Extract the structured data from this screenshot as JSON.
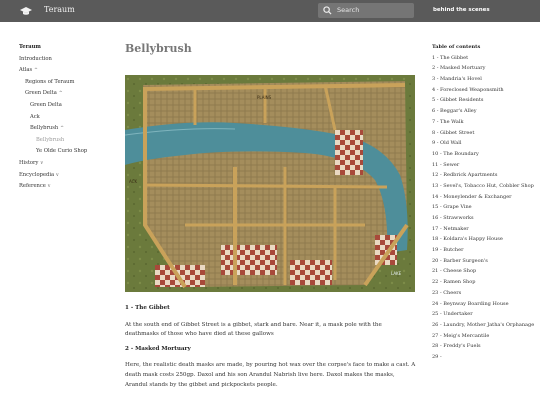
{
  "header": {
    "site_title": "Teraum",
    "search_placeholder": "Search",
    "right_link": "behind the scenes",
    "logo_icon": "graduation-cap-icon",
    "search_icon": "search-icon"
  },
  "sidebar": {
    "items": [
      {
        "label": "Teraum",
        "style": "head"
      },
      {
        "label": "Introduction"
      },
      {
        "label": "Atlas",
        "chevron": "^"
      },
      {
        "label": "Regions of Teraum"
      },
      {
        "label": "Green Delta",
        "chevron": "^"
      },
      {
        "label": "Green Delta"
      },
      {
        "label": "Ack"
      },
      {
        "label": "Bellybrush",
        "chevron": "^"
      },
      {
        "label": "Bellybrush",
        "style": "active"
      },
      {
        "label": "Ye Olde Curio Shop"
      },
      {
        "label": "History",
        "chevron": "v"
      },
      {
        "label": "Encyclopedia",
        "chevron": "v"
      },
      {
        "label": "Reference",
        "chevron": "v"
      }
    ]
  },
  "main": {
    "title": "Bellybrush",
    "map_labels": {
      "plains": "PLAINS",
      "ack": "ACK",
      "lake": "LAKE"
    },
    "sections": [
      {
        "heading": "1 - The Gibbet",
        "text": "At the south end of Gibbet Street is a gibbet, stark and bare. Near it, a mask pole with the deathmasks of those who have died at these gallows"
      },
      {
        "heading": "2 - Masked Mortuary",
        "text": "Here, the realistic death masks are made, by pouring hot wax over the corpse's face to make a cast. A death mask costs 250gp. Daxol and his son Arandul Nabrish live here. Daxol makes the masks, Arandul stands by the gibbet and pickpockets people."
      }
    ]
  },
  "toc": {
    "heading": "Table of contents",
    "items": [
      "1 - The Gibbet",
      "2 - Masked Mortuary",
      "3 - Mandria's Hovel",
      "4 - Foreclosed Weaponsmith",
      "5 - Gibbet Residents",
      "6 - Beggar's Alley",
      "7 - The Walk",
      "8 - Gibbet Street",
      "9 - Old Wall",
      "10 - The Boundary",
      "11 - Sewer",
      "12 - Redbrick Apartments",
      "13 - Sevel's, Tobacco Hut, Cobbler Shop",
      "14 - Moneylender & Exchanger",
      "15 - Grape Vine",
      "16 - Strawworks",
      "17 - Netmaker",
      "18 - Koldara's Happy House",
      "19 - Butcher",
      "20 - Barber Surgeon's",
      "21 - Cheese Shop",
      "22 - Ramen Shop",
      "23 - Cheers",
      "24 - Beynway Boarding House",
      "25 - Undertaker",
      "26 - Laundry, Mother Jatha's Orphanage",
      "27 - Meig's Mercantile",
      "28 - Freddy's Fuels",
      "29 -"
    ]
  },
  "colors": {
    "topbar": "#5a5a5a",
    "grass": "#6b7a3c",
    "road": "#c9a25a",
    "water": "#4e8e9a",
    "checker": "#a8493a"
  }
}
